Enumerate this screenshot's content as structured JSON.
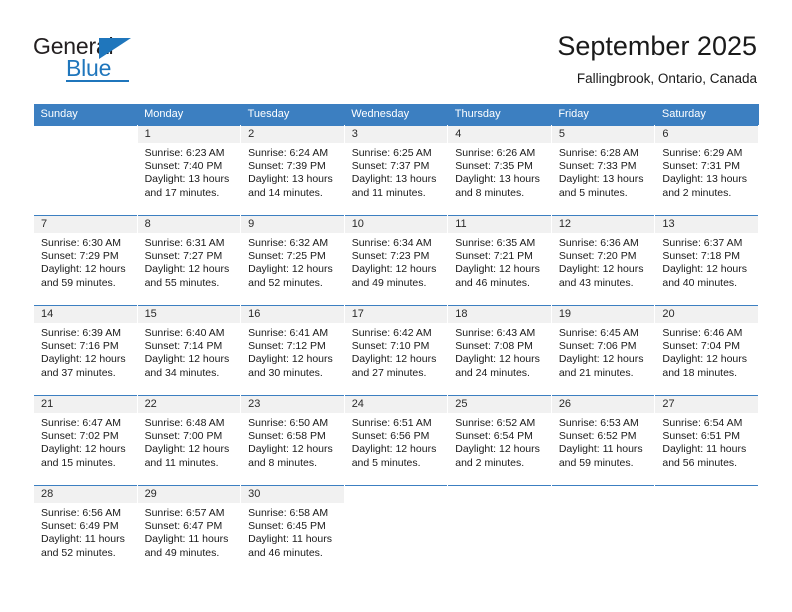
{
  "brand": {
    "name_top": "General",
    "name_bottom": "Blue",
    "accent_color": "#1f76bc"
  },
  "header": {
    "title": "September 2025",
    "subtitle": "Fallingbrook, Ontario, Canada"
  },
  "calendar": {
    "header_bg": "#3c7fc1",
    "daynum_bg": "#f1f1f1",
    "weekday_labels": [
      "Sunday",
      "Monday",
      "Tuesday",
      "Wednesday",
      "Thursday",
      "Friday",
      "Saturday"
    ],
    "labels": {
      "sunrise": "Sunrise:",
      "sunset": "Sunset:",
      "daylight": "Daylight:"
    },
    "weeks": [
      [
        {
          "day": ""
        },
        {
          "day": "1",
          "sunrise": "Sunrise: 6:23 AM",
          "sunset": "Sunset: 7:40 PM",
          "daylight_line1": "Daylight: 13 hours",
          "daylight_line2": "and 17 minutes."
        },
        {
          "day": "2",
          "sunrise": "Sunrise: 6:24 AM",
          "sunset": "Sunset: 7:39 PM",
          "daylight_line1": "Daylight: 13 hours",
          "daylight_line2": "and 14 minutes."
        },
        {
          "day": "3",
          "sunrise": "Sunrise: 6:25 AM",
          "sunset": "Sunset: 7:37 PM",
          "daylight_line1": "Daylight: 13 hours",
          "daylight_line2": "and 11 minutes."
        },
        {
          "day": "4",
          "sunrise": "Sunrise: 6:26 AM",
          "sunset": "Sunset: 7:35 PM",
          "daylight_line1": "Daylight: 13 hours",
          "daylight_line2": "and 8 minutes."
        },
        {
          "day": "5",
          "sunrise": "Sunrise: 6:28 AM",
          "sunset": "Sunset: 7:33 PM",
          "daylight_line1": "Daylight: 13 hours",
          "daylight_line2": "and 5 minutes."
        },
        {
          "day": "6",
          "sunrise": "Sunrise: 6:29 AM",
          "sunset": "Sunset: 7:31 PM",
          "daylight_line1": "Daylight: 13 hours",
          "daylight_line2": "and 2 minutes."
        }
      ],
      [
        {
          "day": "7",
          "sunrise": "Sunrise: 6:30 AM",
          "sunset": "Sunset: 7:29 PM",
          "daylight_line1": "Daylight: 12 hours",
          "daylight_line2": "and 59 minutes."
        },
        {
          "day": "8",
          "sunrise": "Sunrise: 6:31 AM",
          "sunset": "Sunset: 7:27 PM",
          "daylight_line1": "Daylight: 12 hours",
          "daylight_line2": "and 55 minutes."
        },
        {
          "day": "9",
          "sunrise": "Sunrise: 6:32 AM",
          "sunset": "Sunset: 7:25 PM",
          "daylight_line1": "Daylight: 12 hours",
          "daylight_line2": "and 52 minutes."
        },
        {
          "day": "10",
          "sunrise": "Sunrise: 6:34 AM",
          "sunset": "Sunset: 7:23 PM",
          "daylight_line1": "Daylight: 12 hours",
          "daylight_line2": "and 49 minutes."
        },
        {
          "day": "11",
          "sunrise": "Sunrise: 6:35 AM",
          "sunset": "Sunset: 7:21 PM",
          "daylight_line1": "Daylight: 12 hours",
          "daylight_line2": "and 46 minutes."
        },
        {
          "day": "12",
          "sunrise": "Sunrise: 6:36 AM",
          "sunset": "Sunset: 7:20 PM",
          "daylight_line1": "Daylight: 12 hours",
          "daylight_line2": "and 43 minutes."
        },
        {
          "day": "13",
          "sunrise": "Sunrise: 6:37 AM",
          "sunset": "Sunset: 7:18 PM",
          "daylight_line1": "Daylight: 12 hours",
          "daylight_line2": "and 40 minutes."
        }
      ],
      [
        {
          "day": "14",
          "sunrise": "Sunrise: 6:39 AM",
          "sunset": "Sunset: 7:16 PM",
          "daylight_line1": "Daylight: 12 hours",
          "daylight_line2": "and 37 minutes."
        },
        {
          "day": "15",
          "sunrise": "Sunrise: 6:40 AM",
          "sunset": "Sunset: 7:14 PM",
          "daylight_line1": "Daylight: 12 hours",
          "daylight_line2": "and 34 minutes."
        },
        {
          "day": "16",
          "sunrise": "Sunrise: 6:41 AM",
          "sunset": "Sunset: 7:12 PM",
          "daylight_line1": "Daylight: 12 hours",
          "daylight_line2": "and 30 minutes."
        },
        {
          "day": "17",
          "sunrise": "Sunrise: 6:42 AM",
          "sunset": "Sunset: 7:10 PM",
          "daylight_line1": "Daylight: 12 hours",
          "daylight_line2": "and 27 minutes."
        },
        {
          "day": "18",
          "sunrise": "Sunrise: 6:43 AM",
          "sunset": "Sunset: 7:08 PM",
          "daylight_line1": "Daylight: 12 hours",
          "daylight_line2": "and 24 minutes."
        },
        {
          "day": "19",
          "sunrise": "Sunrise: 6:45 AM",
          "sunset": "Sunset: 7:06 PM",
          "daylight_line1": "Daylight: 12 hours",
          "daylight_line2": "and 21 minutes."
        },
        {
          "day": "20",
          "sunrise": "Sunrise: 6:46 AM",
          "sunset": "Sunset: 7:04 PM",
          "daylight_line1": "Daylight: 12 hours",
          "daylight_line2": "and 18 minutes."
        }
      ],
      [
        {
          "day": "21",
          "sunrise": "Sunrise: 6:47 AM",
          "sunset": "Sunset: 7:02 PM",
          "daylight_line1": "Daylight: 12 hours",
          "daylight_line2": "and 15 minutes."
        },
        {
          "day": "22",
          "sunrise": "Sunrise: 6:48 AM",
          "sunset": "Sunset: 7:00 PM",
          "daylight_line1": "Daylight: 12 hours",
          "daylight_line2": "and 11 minutes."
        },
        {
          "day": "23",
          "sunrise": "Sunrise: 6:50 AM",
          "sunset": "Sunset: 6:58 PM",
          "daylight_line1": "Daylight: 12 hours",
          "daylight_line2": "and 8 minutes."
        },
        {
          "day": "24",
          "sunrise": "Sunrise: 6:51 AM",
          "sunset": "Sunset: 6:56 PM",
          "daylight_line1": "Daylight: 12 hours",
          "daylight_line2": "and 5 minutes."
        },
        {
          "day": "25",
          "sunrise": "Sunrise: 6:52 AM",
          "sunset": "Sunset: 6:54 PM",
          "daylight_line1": "Daylight: 12 hours",
          "daylight_line2": "and 2 minutes."
        },
        {
          "day": "26",
          "sunrise": "Sunrise: 6:53 AM",
          "sunset": "Sunset: 6:52 PM",
          "daylight_line1": "Daylight: 11 hours",
          "daylight_line2": "and 59 minutes."
        },
        {
          "day": "27",
          "sunrise": "Sunrise: 6:54 AM",
          "sunset": "Sunset: 6:51 PM",
          "daylight_line1": "Daylight: 11 hours",
          "daylight_line2": "and 56 minutes."
        }
      ],
      [
        {
          "day": "28",
          "sunrise": "Sunrise: 6:56 AM",
          "sunset": "Sunset: 6:49 PM",
          "daylight_line1": "Daylight: 11 hours",
          "daylight_line2": "and 52 minutes."
        },
        {
          "day": "29",
          "sunrise": "Sunrise: 6:57 AM",
          "sunset": "Sunset: 6:47 PM",
          "daylight_line1": "Daylight: 11 hours",
          "daylight_line2": "and 49 minutes."
        },
        {
          "day": "30",
          "sunrise": "Sunrise: 6:58 AM",
          "sunset": "Sunset: 6:45 PM",
          "daylight_line1": "Daylight: 11 hours",
          "daylight_line2": "and 46 minutes."
        },
        {
          "day": ""
        },
        {
          "day": ""
        },
        {
          "day": ""
        },
        {
          "day": ""
        }
      ]
    ]
  }
}
